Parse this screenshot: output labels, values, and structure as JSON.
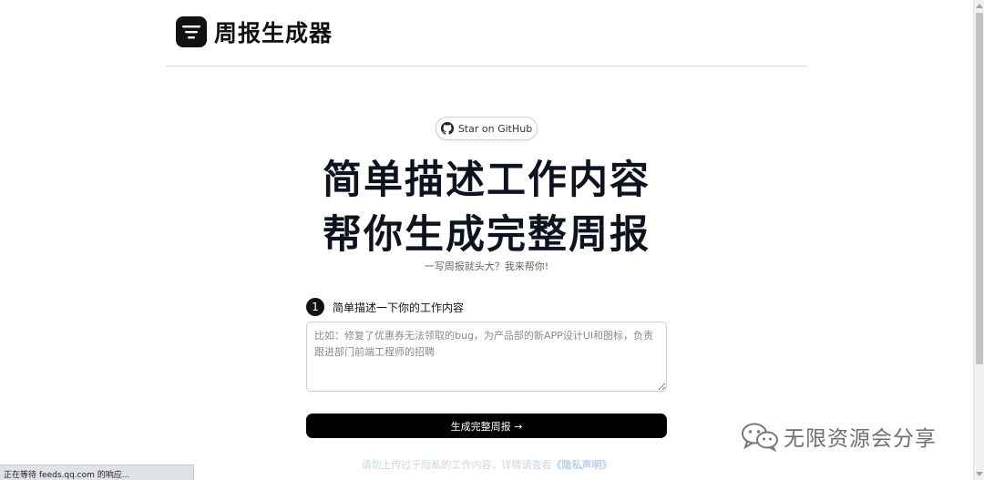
{
  "header": {
    "brand": "周报生成器"
  },
  "github_button": {
    "label": "Star on GitHub"
  },
  "hero": {
    "line1": "简单描述工作内容",
    "line2": "帮你生成完整周报",
    "tagline": "一写周报就头大？我来帮你!"
  },
  "step": {
    "number": "1",
    "label": "简单描述一下你的工作内容"
  },
  "description": {
    "value": "",
    "placeholder": "比如：修复了优惠券无法领取的bug，为产品部的新APP设计UI和图标，负责跟进部门前端工程师的招聘"
  },
  "generate_button": {
    "label": "生成完整周报 →"
  },
  "privacy": {
    "text": "请勿上传过于隐私的工作内容，详情请查看",
    "link": "《隐私声明》"
  },
  "statusbar": {
    "text": "正在等待 feeds.qq.com 的响应..."
  },
  "watermark": {
    "text": "无限资源会分享"
  }
}
